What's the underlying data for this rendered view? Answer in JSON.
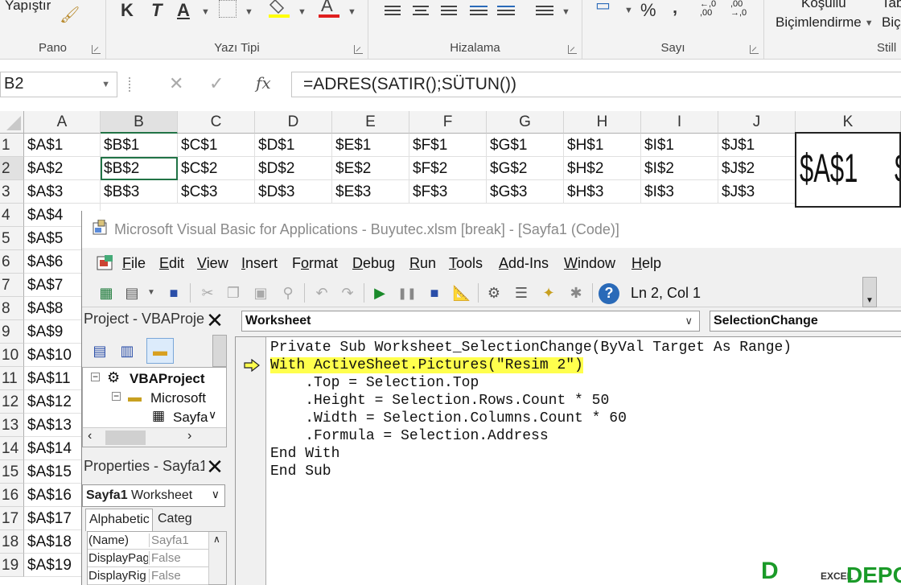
{
  "ribbon": {
    "pano": {
      "paste_label": "Yapıştır",
      "group_label": "Pano"
    },
    "font": {
      "bold": "K",
      "italic": "T",
      "underline": "A",
      "group_label": "Yazı Tipi"
    },
    "alignment": {
      "group_label": "Hizalama"
    },
    "number": {
      "percent": "%",
      "comma": "‚",
      "inc_decimal": "←,0 ,00",
      "dec_decimal": ",00 →,0",
      "group_label": "Sayı"
    },
    "styles": {
      "conditional_line1": "Koşullu",
      "conditional_line2": "Biçimlendirme",
      "table_line1": "Tab",
      "table_line2": "Biç",
      "group_label": "Still"
    }
  },
  "formula_bar": {
    "name_box": "B2",
    "fx": "fx",
    "formula": "=ADRES(SATIR();SÜTUN())"
  },
  "sheet": {
    "columns": [
      "A",
      "B",
      "C",
      "D",
      "E",
      "F",
      "G",
      "H",
      "I",
      "J",
      "K"
    ],
    "rows": [
      [
        "1",
        "$A$1",
        "$B$1",
        "$C$1",
        "$D$1",
        "$E$1",
        "$F$1",
        "$G$1",
        "$H$1",
        "$I$1",
        "$J$1"
      ],
      [
        "2",
        "$A$2",
        "$B$2",
        "$C$2",
        "$D$2",
        "$E$2",
        "$F$2",
        "$G$2",
        "$H$2",
        "$I$2",
        "$J$2"
      ],
      [
        "3",
        "$A$3",
        "$B$3",
        "$C$3",
        "$D$3",
        "$E$3",
        "$F$3",
        "$G$3",
        "$H$3",
        "$I$3",
        "$J$3"
      ],
      [
        "4",
        "$A$4"
      ],
      [
        "5",
        "$A$5"
      ],
      [
        "6",
        "$A$6"
      ],
      [
        "7",
        "$A$7"
      ],
      [
        "8",
        "$A$8"
      ],
      [
        "9",
        "$A$9"
      ],
      [
        "10",
        "$A$10"
      ],
      [
        "11",
        "$A$11"
      ],
      [
        "12",
        "$A$12"
      ],
      [
        "13",
        "$A$13"
      ],
      [
        "14",
        "$A$14"
      ],
      [
        "15",
        "$A$15"
      ],
      [
        "16",
        "$A$16"
      ],
      [
        "17",
        "$A$17"
      ],
      [
        "18",
        "$A$18"
      ],
      [
        "19",
        "$A$19"
      ]
    ],
    "picture_text": "$A$1",
    "picture_text2": "$"
  },
  "vba": {
    "title": "Microsoft Visual Basic for Applications - Buyutec.xlsm [break] - [Sayfa1 (Code)]",
    "menu": [
      "File",
      "Edit",
      "View",
      "Insert",
      "Format",
      "Debug",
      "Run",
      "Tools",
      "Add-Ins",
      "Window",
      "Help"
    ],
    "position": "Ln 2, Col 1",
    "project": {
      "title": "Project - VBAProje",
      "tree_root": "VBAProject",
      "tree_folder": "Microsoft",
      "tree_sheet": "Sayfa"
    },
    "properties": {
      "title": "Properties - Sayfa1",
      "object_name": "Sayfa1",
      "object_type": "Worksheet",
      "tab_alphabetic": "Alphabetic",
      "tab_categorized": "Categ",
      "rows": [
        {
          "name": "(Name)",
          "value": "Sayfa1"
        },
        {
          "name": "DisplayPag",
          "value": "False"
        },
        {
          "name": "DisplayRig",
          "value": "False"
        }
      ]
    },
    "object_combo": "Worksheet",
    "proc_combo": "SelectionChange",
    "code_lines": [
      "Private Sub Worksheet_SelectionChange(ByVal Target As Range)",
      "With ActiveSheet.Pictures(\"Resim 2\")",
      "    .Top = Selection.Top",
      "    .Height = Selection.Rows.Count * 50",
      "    .Width = Selection.Columns.Count * 60",
      "    .Formula = Selection.Address",
      "End With",
      "End Sub"
    ]
  },
  "colors": {
    "highlight": "#ffff4d",
    "watermark": "#1a9a28"
  },
  "watermark": {
    "left": "D",
    "small": "EXCEL",
    "right": "DEPO"
  }
}
